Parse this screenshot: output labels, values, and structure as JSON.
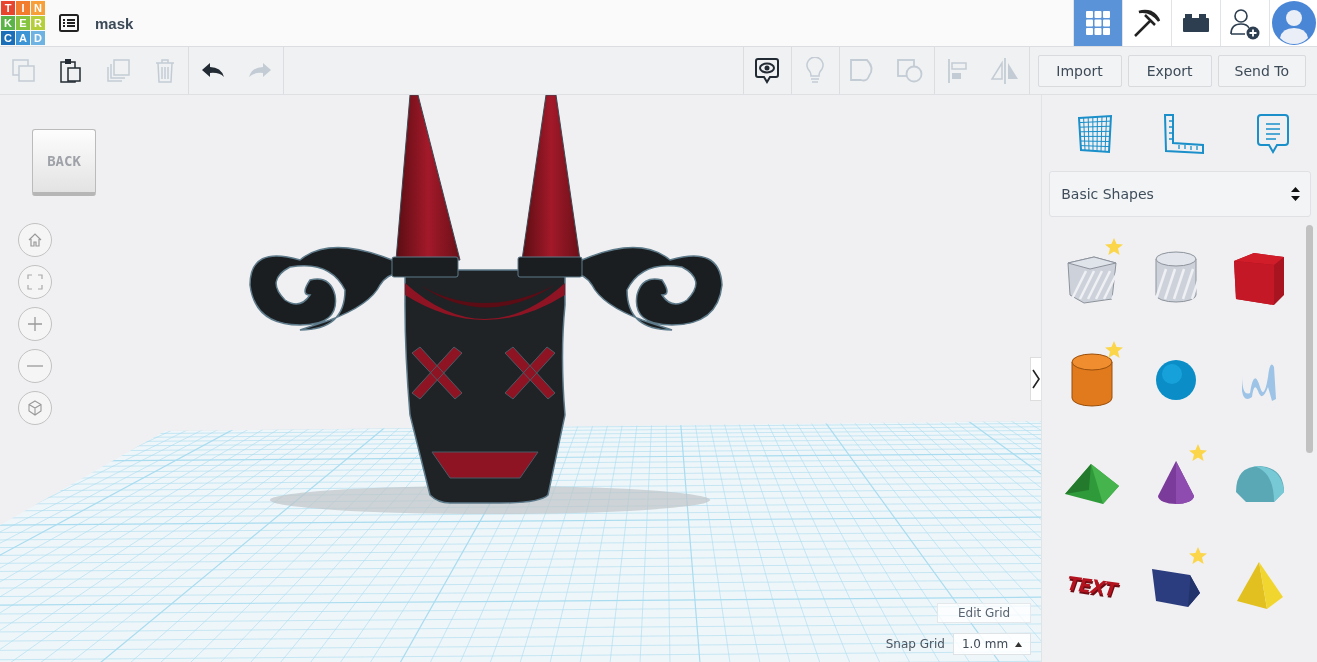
{
  "logo": {
    "letters": [
      {
        "char": "T",
        "color": "#e8452f"
      },
      {
        "char": "I",
        "color": "#f27c2e"
      },
      {
        "char": "N",
        "color": "#f7a03a"
      },
      {
        "char": "K",
        "color": "#5bb447"
      },
      {
        "char": "E",
        "color": "#86c43f"
      },
      {
        "char": "R",
        "color": "#b5cf3a"
      },
      {
        "char": "C",
        "color": "#1b6fb8"
      },
      {
        "char": "A",
        "color": "#3d95d6"
      },
      {
        "char": "D",
        "color": "#6fb3e3"
      }
    ]
  },
  "design_title": "mask",
  "top_nav": [
    {
      "kind": "grid",
      "selected": true
    },
    {
      "kind": "pickaxe",
      "selected": false
    },
    {
      "kind": "bricks",
      "selected": false
    },
    {
      "kind": "add-user",
      "selected": false
    },
    {
      "kind": "avatar",
      "selected": false
    }
  ],
  "toolbar_left": [
    {
      "kind": "copy",
      "disabled": true
    },
    {
      "kind": "paste",
      "disabled": false
    },
    {
      "kind": "duplicate",
      "disabled": true
    },
    {
      "kind": "delete",
      "disabled": true
    },
    {
      "kind": "undo",
      "disabled": false
    },
    {
      "kind": "redo",
      "disabled": true
    }
  ],
  "toolbar_right": [
    {
      "kind": "notes",
      "disabled": false
    },
    {
      "kind": "bulb",
      "disabled": true
    },
    {
      "kind": "group",
      "disabled": true
    },
    {
      "kind": "ungroup",
      "disabled": true
    },
    {
      "kind": "align",
      "disabled": true
    },
    {
      "kind": "mirror",
      "disabled": true
    }
  ],
  "action_buttons": [
    "Import",
    "Export",
    "Send To"
  ],
  "view_cube": {
    "face": "BACK"
  },
  "view_controls": [
    {
      "kind": "home"
    },
    {
      "kind": "fit"
    },
    {
      "kind": "zoom-in"
    },
    {
      "kind": "zoom-out"
    },
    {
      "kind": "ortho"
    }
  ],
  "edit_grid": {
    "label": "Edit Grid"
  },
  "snap_grid": {
    "label": "Snap Grid",
    "value": "1.0 mm"
  },
  "panel": {
    "tools": [
      {
        "kind": "workplane"
      },
      {
        "kind": "ruler"
      },
      {
        "kind": "notes"
      }
    ],
    "library": "Basic Shapes",
    "shapes": [
      {
        "kind": "box-hole",
        "favorite": true
      },
      {
        "kind": "cylinder-hole",
        "favorite": false
      },
      {
        "kind": "box",
        "favorite": false
      },
      {
        "kind": "cylinder",
        "favorite": true
      },
      {
        "kind": "sphere",
        "favorite": false
      },
      {
        "kind": "scribble",
        "favorite": false
      },
      {
        "kind": "roof",
        "favorite": false
      },
      {
        "kind": "cone",
        "favorite": true
      },
      {
        "kind": "round-roof",
        "favorite": false
      },
      {
        "kind": "text",
        "favorite": false,
        "text": "TEXT"
      },
      {
        "kind": "polygon",
        "favorite": true
      },
      {
        "kind": "pyramid",
        "favorite": false
      }
    ]
  }
}
